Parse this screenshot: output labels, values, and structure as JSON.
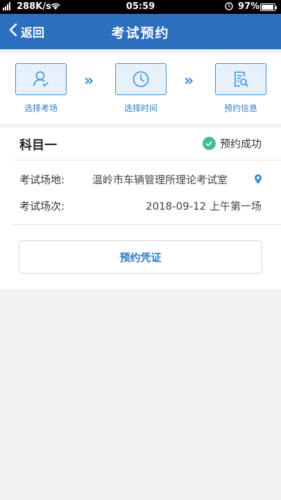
{
  "status_bar": {
    "speed": "288K/s",
    "time": "05:59",
    "battery_pct": "97%"
  },
  "nav": {
    "back_label": "返回",
    "title": "考试预约"
  },
  "steps": [
    {
      "label": "选择考场",
      "icon": "user-check-icon"
    },
    {
      "label": "选择时间",
      "icon": "clock-icon"
    },
    {
      "label": "预约信息",
      "icon": "document-search-icon"
    }
  ],
  "booking": {
    "subject": "科目一",
    "status": "预约成功",
    "location_label": "考试场地:",
    "location_value": "温岭市车辆管理所理论考试室",
    "session_label": "考试场次:",
    "session_value": "2018-09-12 上午第一场",
    "voucher_button": "预约凭证"
  },
  "colors": {
    "primary": "#2d6fbf",
    "accent_blue": "#3a8ed8",
    "success_green": "#3fbf8a"
  }
}
